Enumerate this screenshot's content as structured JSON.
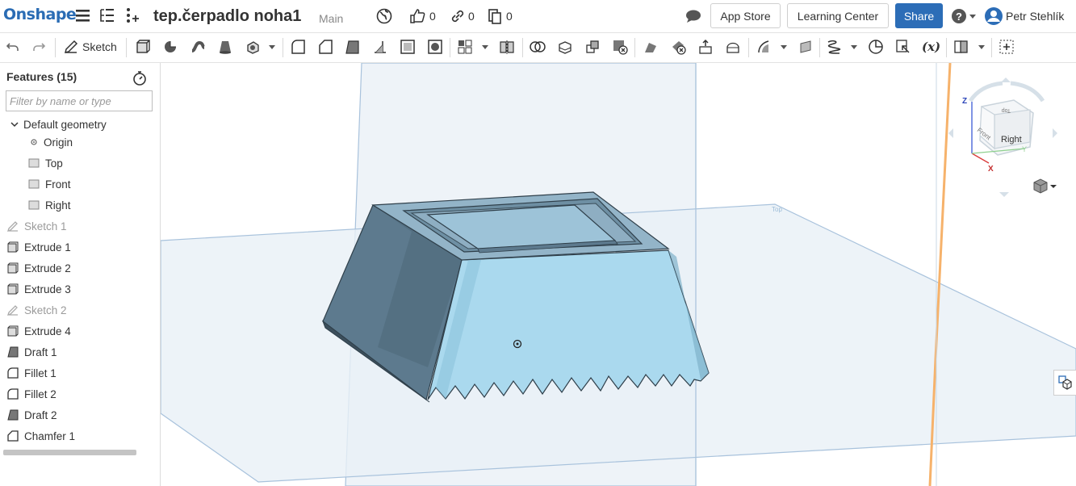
{
  "app": {
    "logo": "Onshape"
  },
  "document": {
    "title": "tep.čerpadlo noha1",
    "branch": "Main"
  },
  "stats": {
    "likes": "0",
    "links": "0",
    "copies": "0"
  },
  "header": {
    "app_store": "App Store",
    "learning_center": "Learning Center",
    "share": "Share",
    "user_name": "Petr Stehlík"
  },
  "toolbar": {
    "sketch_label": "Sketch",
    "variables_label": "(x)"
  },
  "features": {
    "title": "Features (15)",
    "filter_placeholder": "Filter by name or type",
    "group_label": "Default geometry",
    "items": [
      {
        "label": "Origin",
        "icon": "origin-icon",
        "dim": false
      },
      {
        "label": "Top",
        "icon": "plane-icon",
        "dim": false
      },
      {
        "label": "Front",
        "icon": "plane-icon",
        "dim": false
      },
      {
        "label": "Right",
        "icon": "plane-icon",
        "dim": false
      },
      {
        "label": "Sketch 1",
        "icon": "sketch-icon",
        "dim": true
      },
      {
        "label": "Extrude 1",
        "icon": "extrude-icon",
        "dim": false
      },
      {
        "label": "Extrude 2",
        "icon": "extrude-icon",
        "dim": false
      },
      {
        "label": "Extrude 3",
        "icon": "extrude-icon",
        "dim": false
      },
      {
        "label": "Sketch 2",
        "icon": "sketch-icon",
        "dim": true
      },
      {
        "label": "Extrude 4",
        "icon": "extrude-icon",
        "dim": false
      },
      {
        "label": "Draft 1",
        "icon": "draft-icon",
        "dim": false
      },
      {
        "label": "Fillet 1",
        "icon": "fillet-icon",
        "dim": false
      },
      {
        "label": "Fillet 2",
        "icon": "fillet-icon",
        "dim": false
      },
      {
        "label": "Draft 2",
        "icon": "draft-icon",
        "dim": false
      },
      {
        "label": "Chamfer 1",
        "icon": "chamfer-icon",
        "dim": false
      }
    ]
  },
  "viewcube": {
    "face_right": "Right",
    "face_front": "Front",
    "face_top": "Top",
    "axis_z": "Z",
    "axis_x": "X",
    "axis_y": "Y"
  },
  "colors": {
    "brand": "#2a6cb4",
    "share": "#2c6db7",
    "part": "#a9d6ea",
    "plane": "#9cbcd8"
  }
}
